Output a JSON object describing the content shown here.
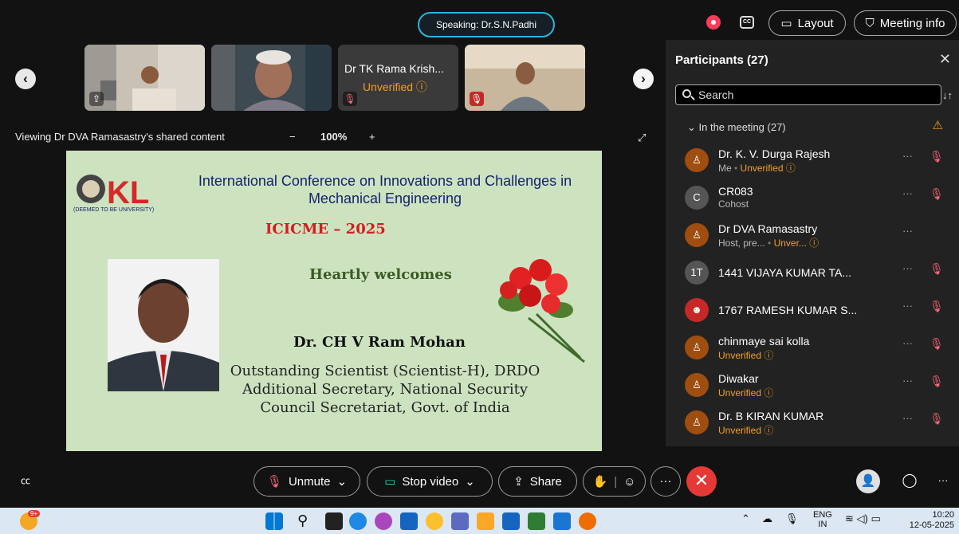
{
  "top": {
    "speaking": "Speaking: Dr.S.N.Padhi",
    "cc_label": "CC",
    "layout_label": "Layout",
    "meeting_info_label": "Meeting info"
  },
  "strip": {
    "tile3_name": "Dr TK Rama Krish...",
    "tile3_status": "Unverified"
  },
  "viewing": {
    "label": "Viewing Dr DVA Ramasastry's shared content",
    "zoom": "100%",
    "zoom_minus": "−",
    "zoom_plus": "+"
  },
  "slide": {
    "logo_text": "(DEEMED TO BE UNIVERSITY)",
    "logo_letters": "KL",
    "title": "International Conference on Innovations and Challenges in Mechanical Engineering",
    "acronym": "ICICME – 2025",
    "welcome": "Heartly welcomes",
    "guest_name": "Dr. CH V Ram Mohan",
    "guest_desc": "Outstanding Scientist (Scientist-H), DRDO Additional Secretary, National Security Council Secretariat, Govt. of India"
  },
  "participants": {
    "title": "Participants (27)",
    "search_placeholder": "Search",
    "section": "In the meeting (27)",
    "rows": [
      {
        "name": "Dr. K. V. Durga Rajesh",
        "sub": "Me",
        "status": "Unverified",
        "avatar": "person",
        "color": "#a04d10"
      },
      {
        "name": "CR083",
        "sub": "Cohost",
        "status": "",
        "avatar": "C",
        "color": "#555555"
      },
      {
        "name": "Dr DVA Ramasastry",
        "sub": "Host, pre...",
        "status": "Unver...",
        "avatar": "person",
        "color": "#a04d10"
      },
      {
        "name": "1441 VIJAYA KUMAR TA...",
        "sub": "",
        "status": "",
        "avatar": "1T",
        "color": "#555555"
      },
      {
        "name": "1767 RAMESH KUMAR S...",
        "sub": "",
        "status": "",
        "avatar": "photo",
        "color": "#c62828"
      },
      {
        "name": "chinmaye sai kolla",
        "sub": "",
        "status": "Unverified",
        "avatar": "person",
        "color": "#a04d10"
      },
      {
        "name": "Diwakar",
        "sub": "",
        "status": "Unverified",
        "avatar": "person",
        "color": "#a04d10"
      },
      {
        "name": "Dr. B KIRAN KUMAR",
        "sub": "",
        "status": "Unverified",
        "avatar": "person",
        "color": "#a04d10"
      }
    ]
  },
  "toolbar": {
    "unmute": "Unmute",
    "stop_video": "Stop video",
    "share": "Share"
  },
  "taskbar": {
    "lang": "ENG",
    "region": "IN",
    "time": "10:20",
    "date": "12-05-2025",
    "notif_badge": "9+"
  }
}
